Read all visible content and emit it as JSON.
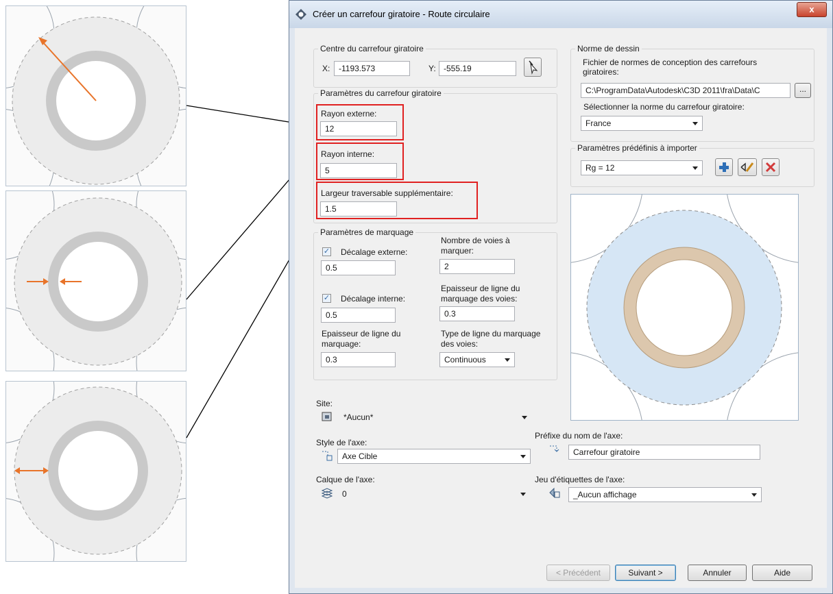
{
  "dialog": {
    "title": "Créer un carrefour giratoire - Route circulaire",
    "close_label": "x"
  },
  "centre": {
    "group_label": "Centre du carrefour giratoire",
    "x_label": "X:",
    "x_value": "-1193.573",
    "y_label": "Y:",
    "y_value": "-555.19"
  },
  "params": {
    "group_label": "Paramètres du carrefour giratoire",
    "outer_radius_label": "Rayon externe:",
    "outer_radius_value": "12",
    "inner_radius_label": "Rayon interne:",
    "inner_radius_value": "5",
    "extra_width_label": "Largeur traversable supplémentaire:",
    "extra_width_value": "1.5"
  },
  "marking": {
    "group_label": "Paramètres de marquage",
    "outer_offset_label": "Décalage externe:",
    "outer_offset_checked": true,
    "outer_offset_value": "0.5",
    "lanes_label_1": "Nombre de voies à",
    "lanes_label_2": "marquer:",
    "lanes_value": "2",
    "inner_offset_label": "Décalage interne:",
    "inner_offset_checked": true,
    "inner_offset_value": "0.5",
    "lane_thickness_label_1": "Epaisseur de ligne du",
    "lane_thickness_label_2": "marquage des voies:",
    "lane_thickness_value": "0.3",
    "line_thickness_label_1": "Epaisseur de ligne du",
    "line_thickness_label_2": "marquage:",
    "line_thickness_value": "0.3",
    "line_type_label_1": "Type de ligne du marquage",
    "line_type_label_2": "des voies:",
    "line_type_value": "Continuous"
  },
  "standard": {
    "group_label": "Norme de dessin",
    "file_label_1": "Fichier de normes de conception des carrefours",
    "file_label_2": "giratoires:",
    "file_value": "C:\\ProgramData\\Autodesk\\C3D 2011\\fra\\Data\\C",
    "browse_label": "...",
    "select_label": "Sélectionner la norme du carrefour giratoire:",
    "select_value": "France"
  },
  "presets": {
    "group_label": "Paramètres prédéfinis à importer",
    "value": "Rg = 12"
  },
  "bottom": {
    "site_label": "Site:",
    "site_value": "*Aucun*",
    "axis_style_label": "Style de l'axe:",
    "axis_style_value": "Axe Cible",
    "axis_layer_label": "Calque de l'axe:",
    "axis_layer_value": "0",
    "prefix_label": "Préfixe du nom de l'axe:",
    "prefix_value": "Carrefour giratoire",
    "label_set_label": "Jeu d'étiquettes de l'axe:",
    "label_set_value": "_Aucun affichage"
  },
  "buttons": {
    "previous": "< Précédent",
    "next": "Suivant >",
    "cancel": "Annuler",
    "help": "Aide"
  },
  "colors": {
    "highlight_box": "#e02020",
    "arrow_orange": "#e8742a",
    "preview_outer": "#d6e6f5",
    "preview_ring": "#dcc7ad"
  },
  "icons": {
    "title": "roundabout-icon",
    "pick": "pick-point-icon",
    "add": "plus-icon",
    "edit": "edit-icon",
    "delete": "delete-icon"
  }
}
